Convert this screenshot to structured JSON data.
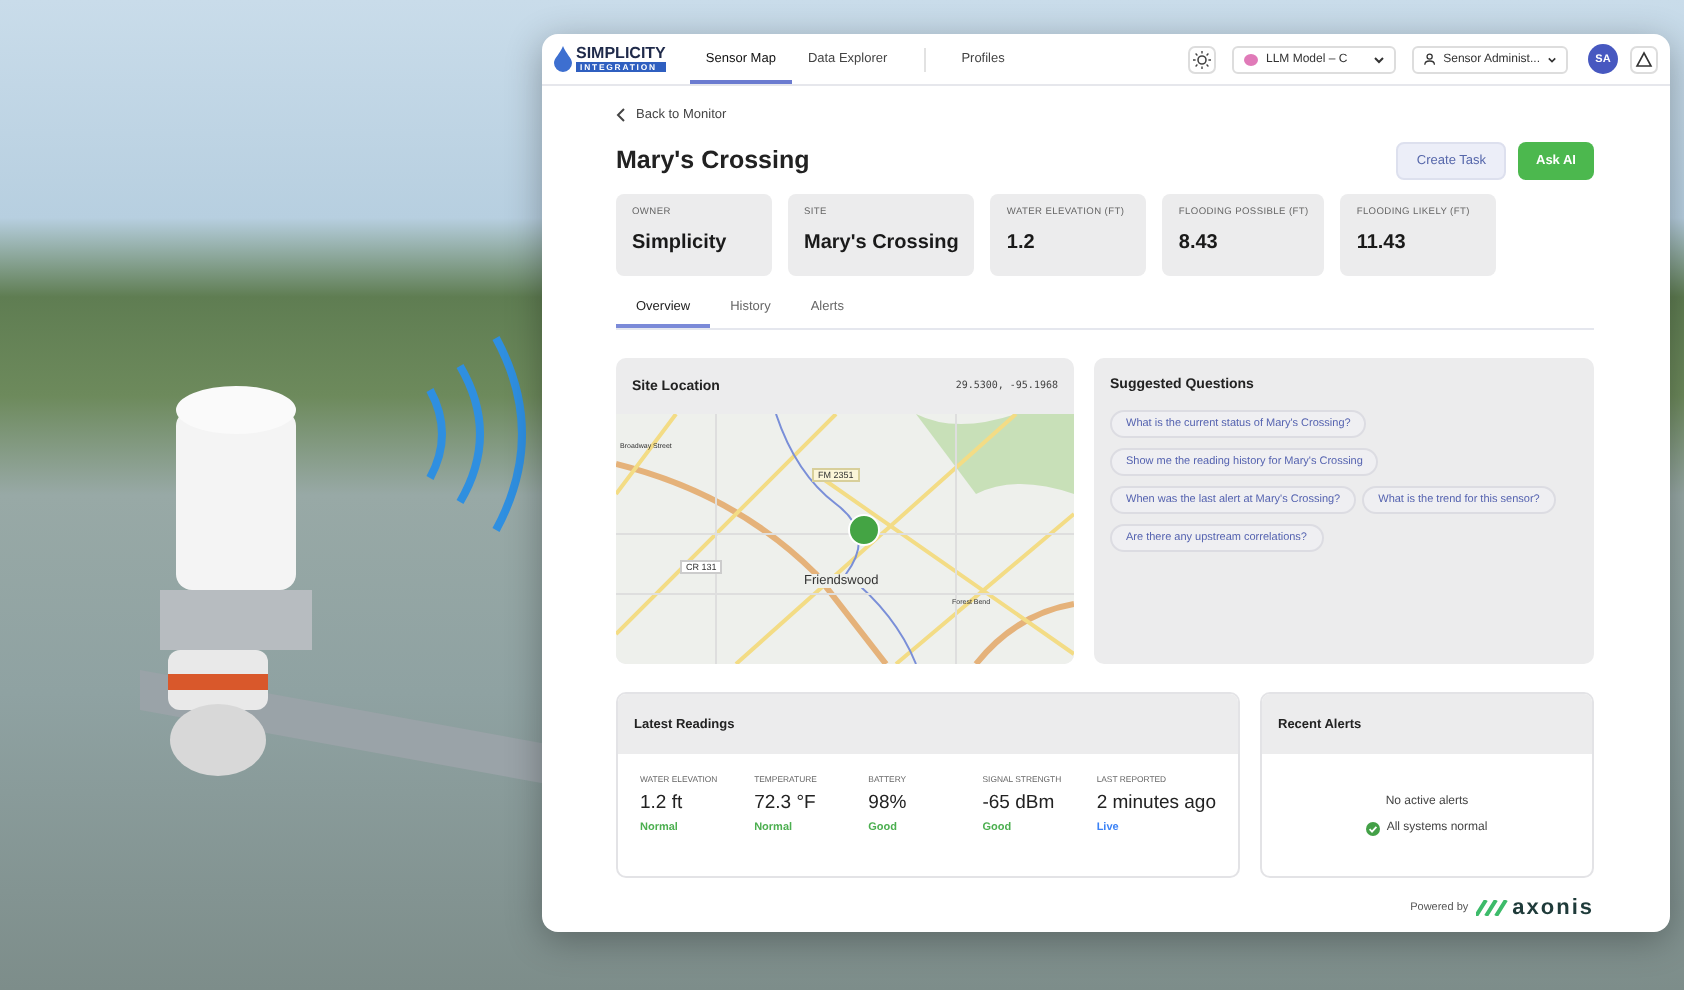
{
  "brand": {
    "name": "SIMPLICITY",
    "tagline": "INTEGRATION"
  },
  "nav": [
    {
      "label": "Sensor Map",
      "selected": true
    },
    {
      "label": "Data Explorer",
      "selected": false
    },
    {
      "label": "Profiles",
      "selected": false
    }
  ],
  "model_select": {
    "value": "LLM Model – C"
  },
  "user_menu": {
    "label": "Sensor Administ..."
  },
  "avatar": "SA",
  "back_link": "Back to Monitor",
  "title": "Mary's Crossing",
  "actions": [
    {
      "label": "Create Task",
      "kind": "secondary"
    },
    {
      "label": "Ask AI",
      "kind": "primary"
    }
  ],
  "stats": [
    {
      "label": "OWNER",
      "value": "Simplicity"
    },
    {
      "label": "SITE",
      "value": "Mary's Crossing"
    },
    {
      "label": "WATER ELEVATION (FT)",
      "value": "1.2"
    },
    {
      "label": "FLOODING POSSIBLE (FT)",
      "value": "8.43"
    },
    {
      "label": "FLOODING LIKELY (FT)",
      "value": "11.43"
    }
  ],
  "tabs": [
    {
      "label": "Overview",
      "selected": true
    },
    {
      "label": "History",
      "selected": false
    },
    {
      "label": "Alerts",
      "selected": false
    }
  ],
  "site_location": {
    "title": "Site Location",
    "coordinates": "29.5300, -95.1968",
    "map_labels": [
      "Broadway Street",
      "FM 2351",
      "CR 131",
      "Friendswood",
      "Forest Bend"
    ]
  },
  "suggested_questions": {
    "title": "Suggested Questions",
    "questions": [
      "What is the current status of Mary's Crossing?",
      "Show me the reading history for Mary's Crossing",
      "When was the last alert at Mary's Crossing?",
      "What is the trend for this sensor?",
      "Are there any upstream correlations?"
    ]
  },
  "latest_readings": {
    "title": "Latest Readings",
    "readings": [
      {
        "label": "WATER ELEVATION",
        "value": "1.2 ft",
        "status": "Normal",
        "color": "#4caf50"
      },
      {
        "label": "TEMPERATURE",
        "value": "72.3 °F",
        "status": "Normal",
        "color": "#4caf50"
      },
      {
        "label": "BATTERY",
        "value": "98%",
        "status": "Good",
        "color": "#4caf50"
      },
      {
        "label": "SIGNAL STRENGTH",
        "value": "-65 dBm",
        "status": "Good",
        "color": "#4caf50"
      },
      {
        "label": "LAST REPORTED",
        "value": "2 minutes ago",
        "status": "Live",
        "color": "#3b82f6"
      }
    ]
  },
  "recent_alerts": {
    "title": "Recent Alerts",
    "message": "No active alerts",
    "status": "All systems normal"
  },
  "footer": {
    "text": "Powered by",
    "brand": "axonis"
  }
}
